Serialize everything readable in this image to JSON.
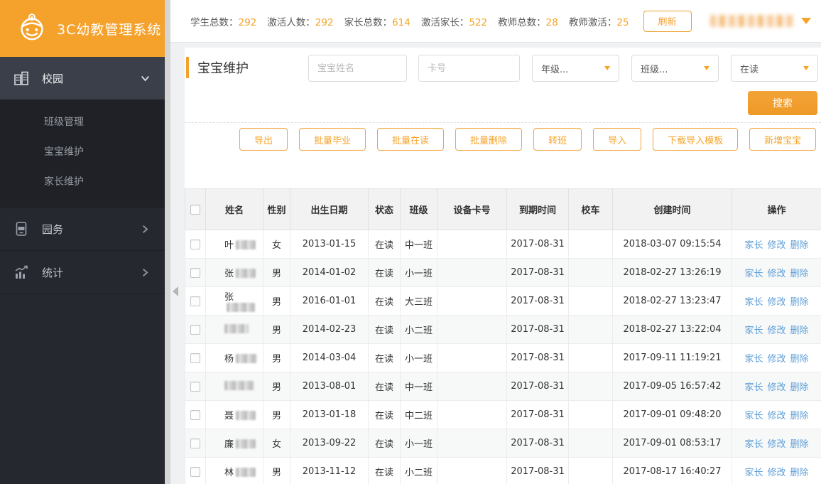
{
  "brand": {
    "title": "3C幼教管理系统",
    "logo_icon": "robot-face-icon"
  },
  "sidebar": {
    "items": [
      {
        "label": "校园",
        "icon": "buildings-icon",
        "chevron": "down",
        "expanded": true,
        "children": [
          {
            "label": "班级管理"
          },
          {
            "label": "宝宝维护"
          },
          {
            "label": "家长维护"
          }
        ]
      },
      {
        "label": "园务",
        "icon": "app-device-icon",
        "chevron": "right",
        "children": []
      },
      {
        "label": "统计",
        "icon": "bar-chart-icon",
        "chevron": "right",
        "children": []
      }
    ]
  },
  "topbar": {
    "colon": "：",
    "stats": [
      {
        "label": "学生总数",
        "value": "292"
      },
      {
        "label": "激活人数",
        "value": "292"
      },
      {
        "label": "家长总数",
        "value": "614"
      },
      {
        "label": "激活家长",
        "value": "522"
      },
      {
        "label": "教师总数",
        "value": "28"
      },
      {
        "label": "教师激活",
        "value": "25"
      }
    ],
    "refresh_label": "刷新"
  },
  "main": {
    "page_title": "宝宝维护",
    "filters": {
      "name_placeholder": "宝宝姓名",
      "card_placeholder": "卡号",
      "grade_value": "年级...",
      "class_value": "班级...",
      "status_value": "在读"
    },
    "search_label": "搜索",
    "actions": [
      "导出",
      "批量毕业",
      "批量在读",
      "批量删除",
      "转班",
      "导入",
      "下载导入模板",
      "新增宝宝"
    ],
    "table": {
      "columns": [
        "",
        "姓名",
        "性别",
        "出生日期",
        "状态",
        "班级",
        "设备卡号",
        "到期时间",
        "校车",
        "创建时间",
        "操作"
      ],
      "row_actions": [
        "家长",
        "修改",
        "删除"
      ],
      "rows": [
        {
          "name": "叶",
          "redact_w": 28,
          "gender": "女",
          "birth": "2013-01-15",
          "status": "在读",
          "class": "中一班",
          "device_card": "",
          "expire": "2017-08-31",
          "bus": "",
          "created": "2018-03-07 09:15:54"
        },
        {
          "name": "张",
          "redact_w": 28,
          "gender": "男",
          "birth": "2014-01-02",
          "status": "在读",
          "class": "小一班",
          "device_card": "",
          "expire": "2017-08-31",
          "bus": "",
          "created": "2018-02-27 13:26:19"
        },
        {
          "name": "张",
          "redact_w": 40,
          "gender": "男",
          "birth": "2016-01-01",
          "status": "在读",
          "class": "大三班",
          "device_card": "",
          "expire": "2017-08-31",
          "bus": "",
          "created": "2018-02-27 13:23:47"
        },
        {
          "name": "",
          "redact_w": 34,
          "gender": "男",
          "birth": "2014-02-23",
          "status": "在读",
          "class": "小二班",
          "device_card": "",
          "expire": "2017-08-31",
          "bus": "",
          "created": "2018-02-27 13:22:04"
        },
        {
          "name": "杨",
          "redact_w": 30,
          "gender": "男",
          "birth": "2014-03-04",
          "status": "在读",
          "class": "小一班",
          "device_card": "",
          "expire": "2017-08-31",
          "bus": "",
          "created": "2017-09-11 11:19:21"
        },
        {
          "name": "",
          "redact_w": 42,
          "gender": "男",
          "birth": "2013-08-01",
          "status": "在读",
          "class": "中一班",
          "device_card": "",
          "expire": "2017-08-31",
          "bus": "",
          "created": "2017-09-05 16:57:42"
        },
        {
          "name": "聂",
          "redact_w": 28,
          "gender": "男",
          "birth": "2013-01-18",
          "status": "在读",
          "class": "中二班",
          "device_card": "",
          "expire": "2017-08-31",
          "bus": "",
          "created": "2017-09-01 09:48:20"
        },
        {
          "name": "廉",
          "redact_w": 28,
          "gender": "女",
          "birth": "2013-09-22",
          "status": "在读",
          "class": "小一班",
          "device_card": "",
          "expire": "2017-08-31",
          "bus": "",
          "created": "2017-09-01 08:53:17"
        },
        {
          "name": "林",
          "redact_w": 28,
          "gender": "男",
          "birth": "2013-11-12",
          "status": "在读",
          "class": "小二班",
          "device_card": "",
          "expire": "2017-08-31",
          "bus": "",
          "created": "2017-08-17 16:40:27"
        }
      ]
    }
  },
  "colors": {
    "brand_orange": "#f5a22d",
    "number_orange": "#f5a428",
    "link_blue": "#5e9fd8",
    "sidebar_dark": "#26282f"
  }
}
